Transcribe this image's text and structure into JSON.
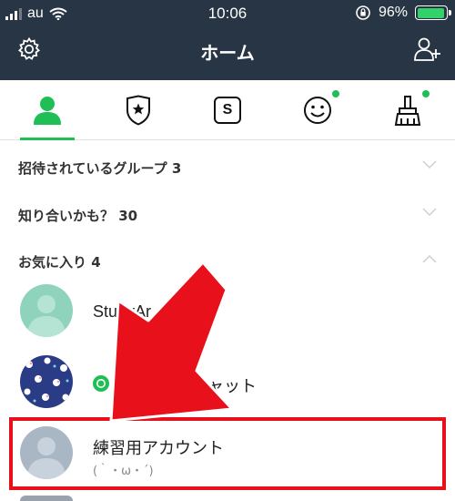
{
  "status_bar": {
    "carrier": "au",
    "time": "10:06",
    "battery_percent": "96%",
    "battery_level": 0.96
  },
  "header": {
    "title": "ホーム",
    "settings_icon": "gear-icon",
    "add_friend_icon": "add-friend-icon"
  },
  "tabs": [
    {
      "name": "friends",
      "icon": "person-icon",
      "active": true
    },
    {
      "name": "badge",
      "icon": "shield-star-icon"
    },
    {
      "name": "stickers",
      "icon": "sticker-s-icon",
      "label": "S"
    },
    {
      "name": "emoji",
      "icon": "smiley-icon",
      "has_dot": true
    },
    {
      "name": "theme",
      "icon": "brush-icon",
      "has_dot": true
    }
  ],
  "sections": {
    "invited_groups": "招待されているグループ 3",
    "maybe_know": "知り合いかも？ 30",
    "favorites": "お気に入り 4"
  },
  "friends": [
    {
      "name": "StudyAr"
    },
    {
      "name": "ャット"
    },
    {
      "name": "練習用アカウント",
      "status": "(｀・ω・´)"
    }
  ],
  "colors": {
    "header_bg": "#283544",
    "accent_green": "#1fbf56",
    "highlight_red": "#e8101a"
  }
}
